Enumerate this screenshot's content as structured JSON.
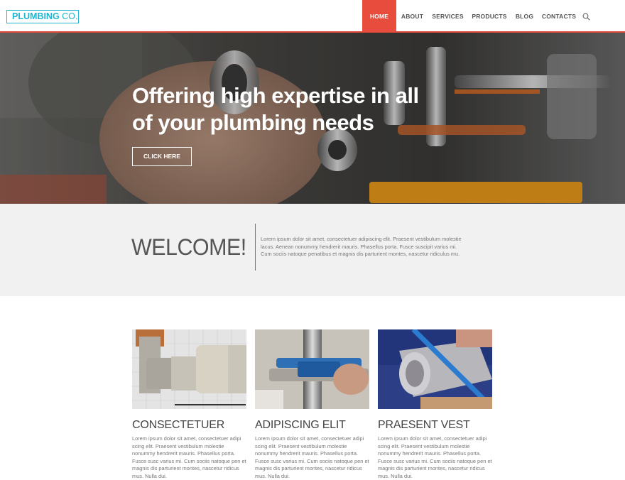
{
  "header": {
    "logo_bold": "PLUMBING",
    "logo_light": " CO.",
    "nav": [
      {
        "label": "HOME",
        "active": true
      },
      {
        "label": "ABOUT",
        "active": false
      },
      {
        "label": "SERVICES",
        "active": false
      },
      {
        "label": "PRODUCTS",
        "active": false
      },
      {
        "label": "BLOG",
        "active": false
      },
      {
        "label": "CONTACTS",
        "active": false
      }
    ]
  },
  "hero": {
    "title_line1": "Offering high expertise in all",
    "title_line2": "of your plumbing needs",
    "button_label": "CLICK HERE"
  },
  "welcome": {
    "title": "WELCOME!",
    "text": "Lorem ipsum dolor sit amet, consectetuer adipiscing elit. Praesent vestibulum molestie lacus. Aenean nonummy hendrerit mauris. Phasellus porta. Fusce suscipit varius mi. Cum sociis natoque penatibus et magnis dis parturient montes, nascetur ridiculus mu."
  },
  "cards": [
    {
      "title": "CONSECTETUER",
      "text": "Lorem ipsum dolor sit amet, consectetuer adipi scing elit. Praesent vestibulum molestie nonummy hendrerit mauris. Phasellus porta. Fusce susc varius mi. Cum sociis natoque pen et magnis dis parturient montes, nascetur ridicus mus. Nulla dui."
    },
    {
      "title": "ADIPISCING ELIT",
      "text": "Lorem ipsum dolor sit amet, consectetuer adipi scing elit. Praesent vestibulum molestie nonummy hendrerit mauris. Phasellus porta. Fusce susc varius mi. Cum sociis natoque pen et magnis dis parturient montes, nascetur ridicus mus. Nulla dui."
    },
    {
      "title": "PRAESENT VEST",
      "text": "Lorem ipsum dolor sit amet, consectetuer adipi scing elit. Praesent vestibulum molestie nonummy hendrerit mauris. Phasellus porta. Fusce susc varius mi. Cum sociis natoque pen et magnis dis parturient montes, nascetur ridicus mus. Nulla dui."
    }
  ],
  "colors": {
    "accent": "#e84c3d",
    "logo": "#1fb5d3",
    "welcome_bg": "#f1f1f1"
  }
}
